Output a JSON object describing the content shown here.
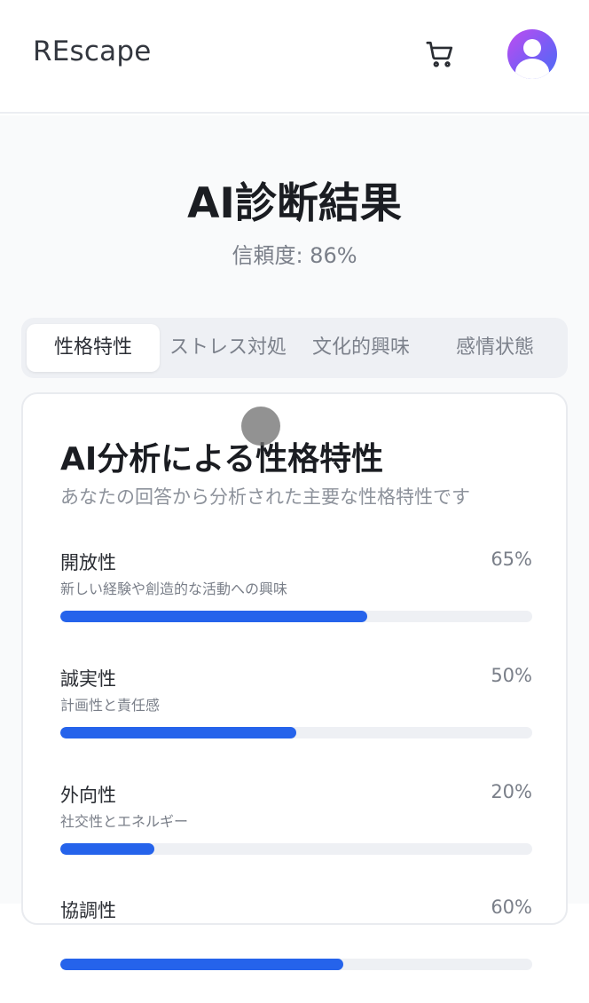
{
  "header": {
    "logo": "REscape",
    "cart_icon": "cart-icon",
    "avatar_icon": "user-avatar-icon"
  },
  "page": {
    "title": "AI診断結果",
    "confidence": "信頼度: 86%"
  },
  "tabs": [
    {
      "label": "性格特性",
      "active": true
    },
    {
      "label": "ストレス対処",
      "active": false
    },
    {
      "label": "文化的興味",
      "active": false
    },
    {
      "label": "感情状態",
      "active": false
    }
  ],
  "card": {
    "title": "AI分析による性格特性",
    "subtitle": "あなたの回答から分析された主要な性格特性です",
    "traits": [
      {
        "name": "開放性",
        "description": "新しい経験や創造的な活動への興味",
        "percent_label": "65%",
        "value": 65
      },
      {
        "name": "誠実性",
        "description": "計画性と責任感",
        "percent_label": "50%",
        "value": 50
      },
      {
        "name": "外向性",
        "description": "社交性とエネルギー",
        "percent_label": "20%",
        "value": 20
      },
      {
        "name": "協調性",
        "description": "",
        "percent_label": "60%",
        "value": 60
      }
    ]
  },
  "colors": {
    "accent": "#2563eb",
    "track": "#eef0f4",
    "avatar_gradient_start": "#c04cf0",
    "avatar_gradient_end": "#4a6df5"
  }
}
